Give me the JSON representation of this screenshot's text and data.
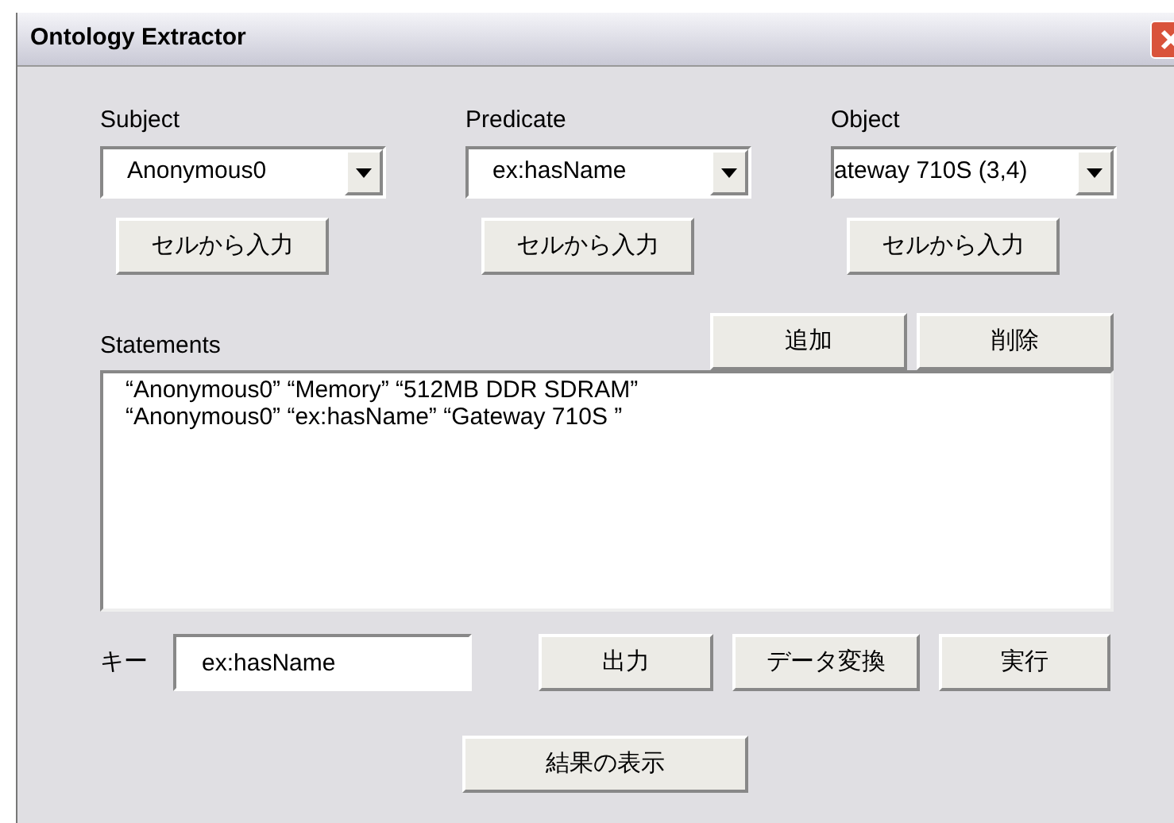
{
  "window": {
    "title": "Ontology Extractor"
  },
  "selectors": [
    {
      "label": "Subject",
      "value": "Anonymous0",
      "button": "セルから入力"
    },
    {
      "label": "Predicate",
      "value": "ex:hasName",
      "button": "セルから入力"
    },
    {
      "label": "Object",
      "value": "ateway 710S (3,4)",
      "button": "セルから入力"
    }
  ],
  "statements": {
    "label": "Statements",
    "buttons": [
      "追加",
      "削除"
    ],
    "items": [
      "“Anonymous0” “Memory” “512MB DDR SDRAM”",
      "“Anonymous0” “ex:hasName” “Gateway 710S ”"
    ]
  },
  "key": {
    "label": "キー",
    "value": "ex:hasName",
    "buttons": [
      "出力",
      "データ変換",
      "実行"
    ]
  },
  "result_button": "結果の表示"
}
